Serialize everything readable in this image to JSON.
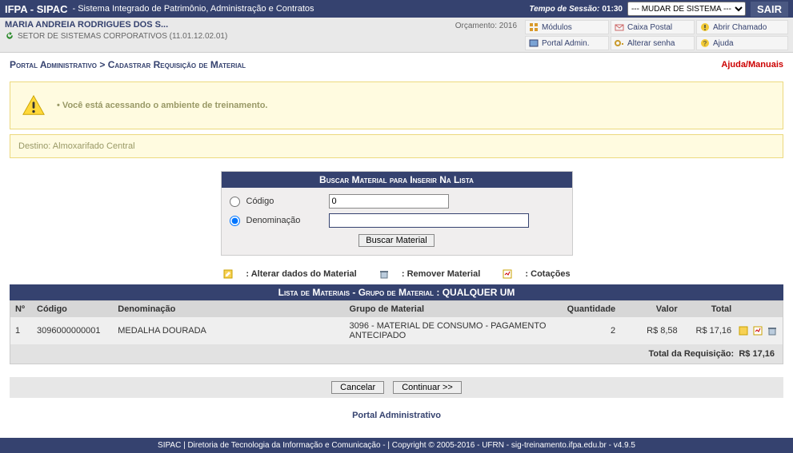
{
  "top": {
    "sys": "IFPA - SIPAC",
    "sub": "- Sistema Integrado de Patrimônio, Administração e Contratos",
    "sess_label": "Tempo de Sessão:",
    "sess_time": "01:30",
    "sys_select": "--- MUDAR DE SISTEMA ---",
    "sair": "SAIR"
  },
  "user": {
    "name": "MARIA ANDREIA RODRIGUES DOS S...",
    "unit": "SETOR DE SISTEMAS CORPORATIVOS (11.01.12.02.01)",
    "orc": "Orçamento: 2016"
  },
  "links": {
    "modulos": "Módulos",
    "caixa": "Caixa Postal",
    "chamado": "Abrir Chamado",
    "portal": "Portal Admin.",
    "senha": "Alterar senha",
    "ajuda": "Ajuda"
  },
  "crumb": {
    "path": "Portal Administrativo > Cadastrar Requisição de Material",
    "help": "Ajuda/Manuais"
  },
  "msg": {
    "bullet": "•",
    "text": "Você está acessando o ambiente de treinamento."
  },
  "destino": "Destino: Almoxarifado Central",
  "search": {
    "title": "Buscar Material para Inserir Na Lista",
    "codigo_lbl": "Código",
    "codigo_val": "0",
    "denom_lbl": "Denominação",
    "denom_val": "",
    "btn": "Buscar Material"
  },
  "legend": {
    "alterar": ": Alterar dados do Material",
    "remover": ": Remover Material",
    "cot": ": Cotações"
  },
  "list": {
    "title_a": "Lista de Materiais - Grupo de Material : ",
    "title_b": "QUALQUER UM",
    "cols": {
      "n": "Nº",
      "codigo": "Código",
      "denom": "Denominação",
      "grupo": "Grupo de Material",
      "qtd": "Quantidade",
      "valor": "Valor",
      "total": "Total"
    },
    "rows": [
      {
        "n": "1",
        "codigo": "3096000000001",
        "denom": "MEDALHA DOURADA",
        "grupo": "3096 - MATERIAL DE CONSUMO - PAGAMENTO ANTECIPADO",
        "qtd": "2",
        "valor": "R$ 8,58",
        "total": "R$ 17,16"
      }
    ],
    "total_lbl": "Total da Requisição:",
    "total_val": "R$ 17,16"
  },
  "btns": {
    "cancelar": "Cancelar",
    "continuar": "Continuar >>"
  },
  "backlink": "Portal Administrativo",
  "footer": "SIPAC | Diretoria de Tecnologia da Informação e Comunicação - | Copyright © 2005-2016 - UFRN - sig-treinamento.ifpa.edu.br - v4.9.5"
}
